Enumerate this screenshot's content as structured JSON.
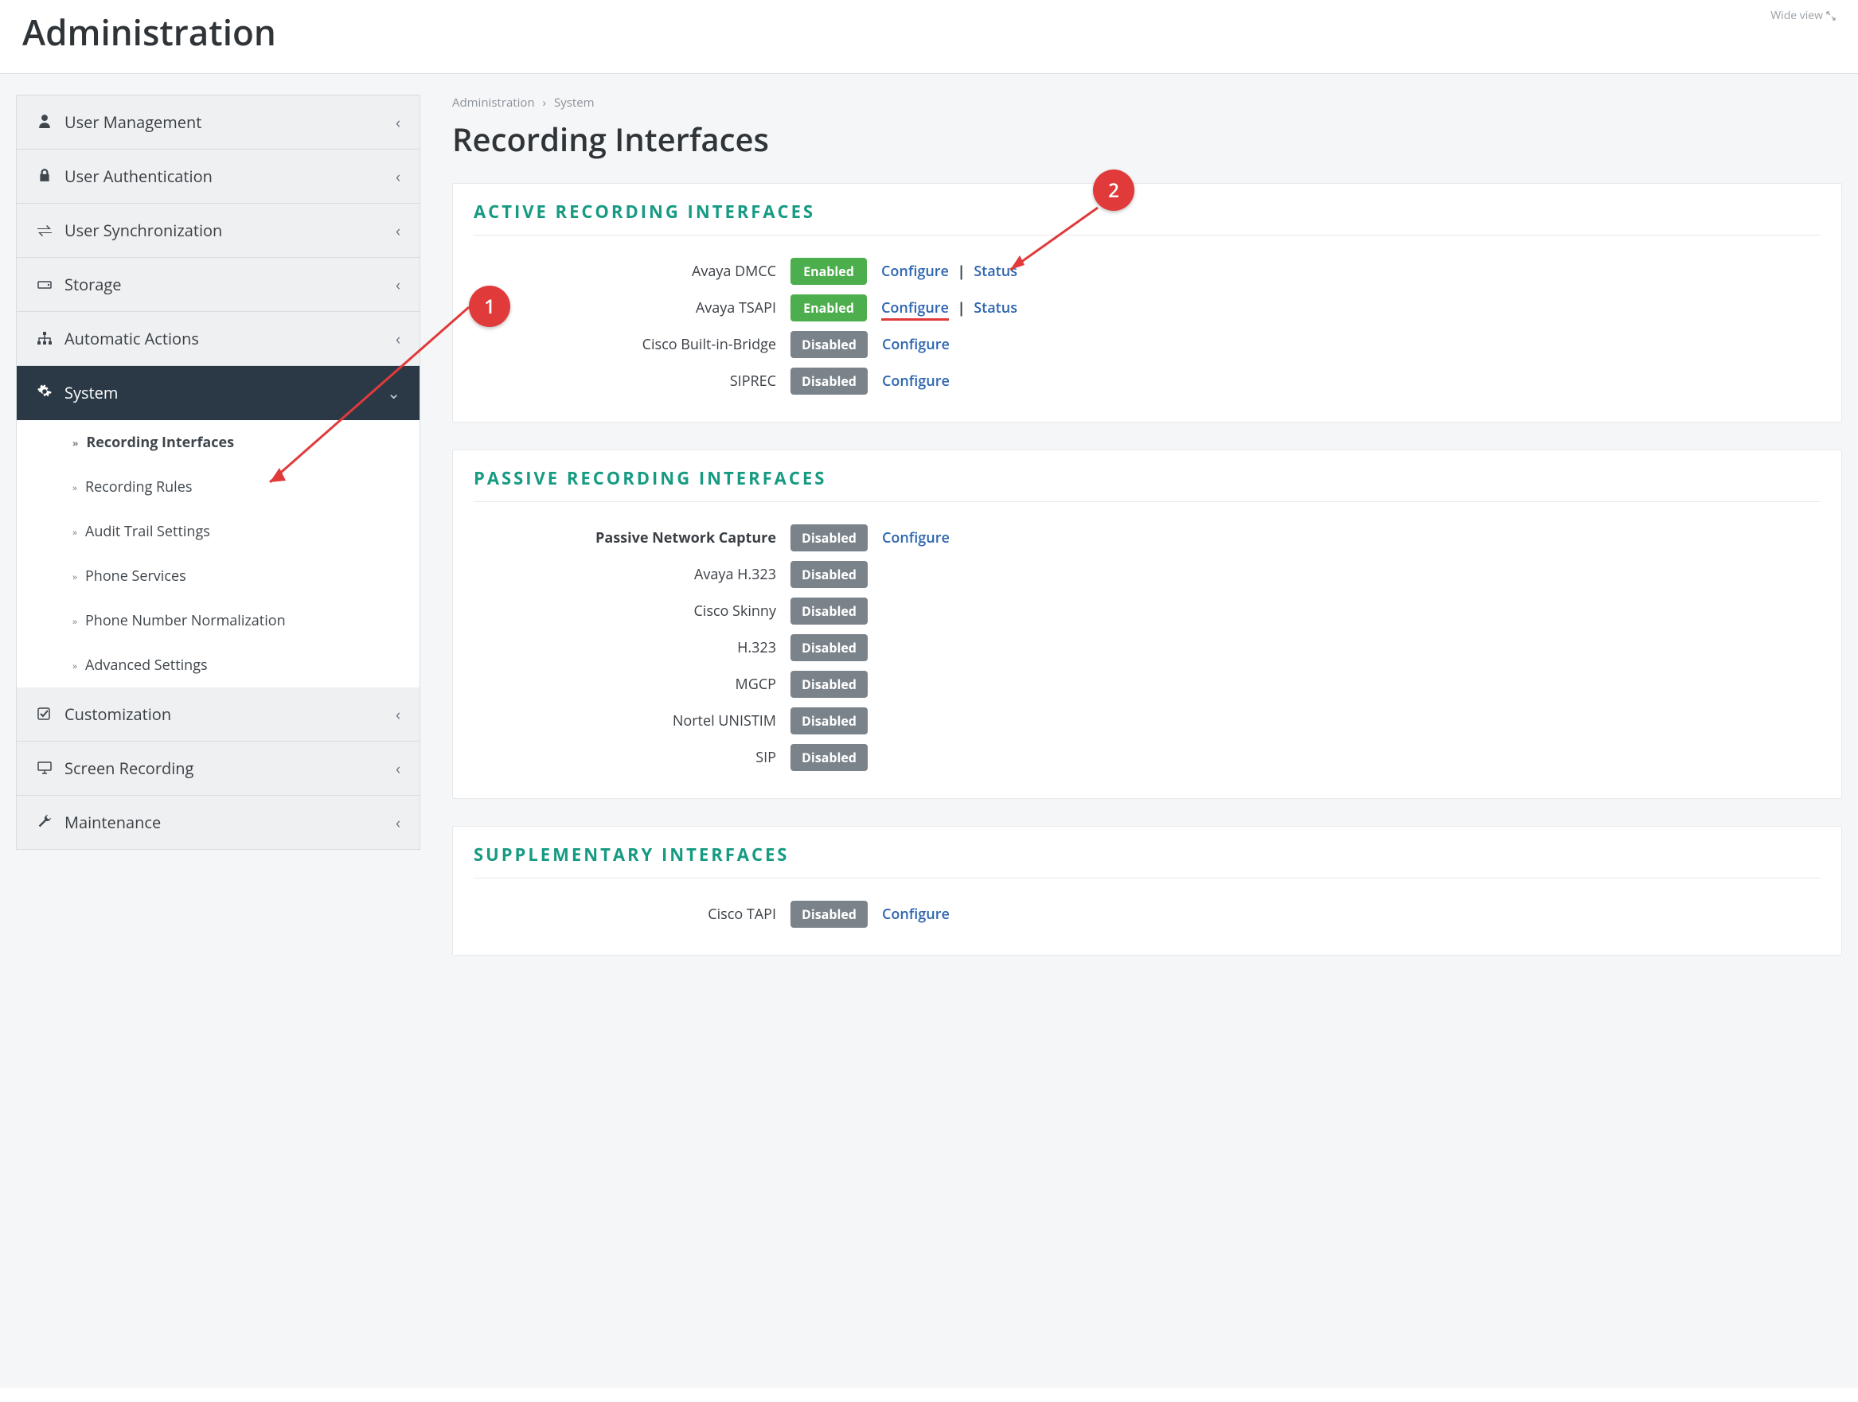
{
  "header": {
    "title": "Administration",
    "wide_view": "Wide view"
  },
  "breadcrumb": {
    "root": "Administration",
    "section": "System"
  },
  "main_title": "Recording Interfaces",
  "sidebar": {
    "items": [
      {
        "icon": "user-icon",
        "label": "User Management"
      },
      {
        "icon": "lock-icon",
        "label": "User Authentication"
      },
      {
        "icon": "sync-icon",
        "label": "User Synchronization"
      },
      {
        "icon": "storage-icon",
        "label": "Storage"
      },
      {
        "icon": "sitemap-icon",
        "label": "Automatic Actions"
      },
      {
        "icon": "gear-icon",
        "label": "System"
      },
      {
        "icon": "check-icon",
        "label": "Customization"
      },
      {
        "icon": "monitor-icon",
        "label": "Screen Recording"
      },
      {
        "icon": "wrench-icon",
        "label": "Maintenance"
      }
    ],
    "system_sub": [
      "Recording Interfaces",
      "Recording Rules",
      "Audit Trail Settings",
      "Phone Services",
      "Phone Number Normalization",
      "Advanced Settings"
    ]
  },
  "sections": {
    "active": {
      "title": "ACTIVE  RECORDING  INTERFACES",
      "rows": [
        {
          "name": "Avaya DMCC",
          "state": "Enabled",
          "configure": "Configure",
          "status": "Status"
        },
        {
          "name": "Avaya TSAPI",
          "state": "Enabled",
          "configure": "Configure",
          "status": "Status"
        },
        {
          "name": "Cisco Built-in-Bridge",
          "state": "Disabled",
          "configure": "Configure"
        },
        {
          "name": "SIPREC",
          "state": "Disabled",
          "configure": "Configure"
        }
      ]
    },
    "passive": {
      "title": "PASSIVE  RECORDING  INTERFACES",
      "rows": [
        {
          "name": "Passive Network Capture",
          "bold": true,
          "state": "Disabled",
          "configure": "Configure"
        },
        {
          "name": "Avaya H.323",
          "state": "Disabled"
        },
        {
          "name": "Cisco Skinny",
          "state": "Disabled"
        },
        {
          "name": "H.323",
          "state": "Disabled"
        },
        {
          "name": "MGCP",
          "state": "Disabled"
        },
        {
          "name": "Nortel UNISTIM",
          "state": "Disabled"
        },
        {
          "name": "SIP",
          "state": "Disabled"
        }
      ]
    },
    "supp": {
      "title": "SUPPLEMENTARY  INTERFACES",
      "rows": [
        {
          "name": "Cisco TAPI",
          "state": "Disabled",
          "configure": "Configure"
        }
      ]
    }
  },
  "annotations": {
    "one": "1",
    "two": "2"
  },
  "colors": {
    "teal": "#169b82",
    "green": "#4cae4c",
    "grey": "#7a828a",
    "red": "#e03a3a",
    "link": "#2d66b0"
  }
}
